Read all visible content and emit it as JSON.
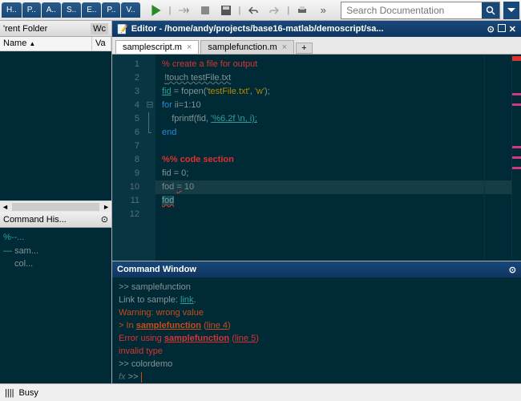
{
  "toolbarTabs": [
    "H..",
    "P..",
    "A..",
    "S..",
    "E..",
    "P..",
    "V.."
  ],
  "search": {
    "placeholder": "Search Documentation"
  },
  "panels": {
    "folder": {
      "title": "'rent Folder",
      "wc": "Wc",
      "cols": {
        "name": "Name",
        "val": "Va"
      }
    },
    "history": {
      "title": "Command His...",
      "items": [
        "%--...",
        "sam...",
        "col..."
      ]
    }
  },
  "editor": {
    "title": "Editor - /home/andy/projects/base16-matlab/demoscript/sa...",
    "tabs": [
      {
        "name": "samplescript.m",
        "active": true
      },
      {
        "name": "samplefunction.m",
        "active": false
      }
    ],
    "lines": 12,
    "code": {
      "l1": "% create a file for output",
      "l2_a": "!",
      "l2_b": "touch testFile.txt",
      "l3_a": "fid",
      "l3_b": " = fopen(",
      "l3_c": "'testFile.txt'",
      "l3_d": ", ",
      "l3_e": "'w'",
      "l3_f": ");",
      "l4_a": "for ",
      "l4_b": "ii=1:10",
      "l5_a": "    fprintf(fid, ",
      "l5_b": "'%6.2f \\n, i);",
      "l6": "end",
      "l8": "%% code section",
      "l9": "fid = 0;",
      "l10_a": "fod ",
      "l10_b": "=",
      "l10_c": " 10",
      "l11": "fod"
    }
  },
  "cmdwin": {
    "title": "Command Window",
    "c1_a": ">> ",
    "c1_b": "samplefunction",
    "c2_a": "Link to sample: ",
    "c2_b": "link",
    "c2_c": ".",
    "c3": "Warning: wrong value",
    "c4_a": "> In ",
    "c4_b": "samplefunction",
    "c4_c": " (",
    "c4_d": "line 4",
    "c4_e": ")",
    "c5_a": "Error using ",
    "c5_b": "samplefunction",
    "c5_c": " (",
    "c5_d": "line 5",
    "c5_e": ")",
    "c6": "invalid type",
    "c7_a": ">> ",
    "c7_b": "colordemo",
    "fx": "fx"
  },
  "status": {
    "busy": "Busy"
  }
}
